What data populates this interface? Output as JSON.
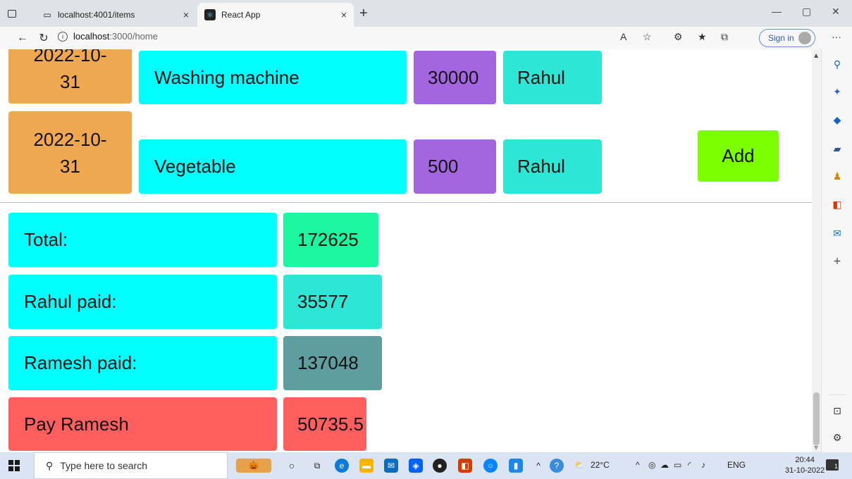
{
  "browser": {
    "tabs": [
      {
        "title": "localhost:4001/items",
        "close": "×"
      },
      {
        "title": "React App",
        "close": "×"
      }
    ],
    "new_tab": "+",
    "url_host": "localhost",
    "url_path": ":3000/home",
    "sign_in": "Sign in",
    "more": "···"
  },
  "rows": [
    {
      "date": "2022-10-31",
      "date_top": "2022-10-",
      "date_bottom": "31",
      "item": "Washing machine",
      "amount": "30000",
      "payer": "Rahul"
    },
    {
      "date": "2022-10-31",
      "date_top": "2022-10-",
      "date_bottom": "31",
      "item": "Vegetable",
      "amount": "500",
      "payer": "Rahul"
    }
  ],
  "add_button": "Add",
  "summary": {
    "total_label": "Total:",
    "total_value": "172625",
    "rahul_label": "Rahul paid:",
    "rahul_value": "35577",
    "ramesh_label": "Ramesh paid:",
    "ramesh_value": "137048",
    "pay_label": "Pay Ramesh",
    "pay_value": "50735.5"
  },
  "colors": {
    "date": "#f0a850",
    "item": "#00ffff",
    "amount": "#a366e0",
    "payer": "#2ee6d6",
    "add": "#7cff00",
    "total_value": "#1af7a0",
    "ramesh_value": "#5f9ea0",
    "pay": "#ff5f5f"
  },
  "taskbar": {
    "search_placeholder": "Type here to search",
    "weather": "22°C",
    "language": "ENG",
    "time": "20:44",
    "date": "31-10-2022",
    "notifications": "1"
  }
}
